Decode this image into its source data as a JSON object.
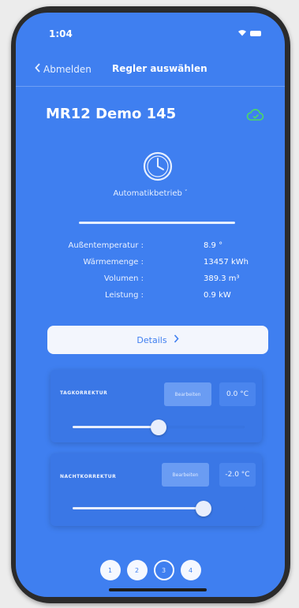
{
  "status_bar": {
    "time": "1:04"
  },
  "nav": {
    "back_label": "Abmelden",
    "title": "Regler auswählen"
  },
  "card": {
    "title": "MR12 Demo 145",
    "mode_label": "Automatikbetrieb",
    "cloud_icon": "cloud-sync-icon",
    "mode_icon": "clock-icon"
  },
  "readings": [
    {
      "label": "Außentemperatur :",
      "value": "8.9 °"
    },
    {
      "label": "Wärmemenge :",
      "value": "13457 kWh"
    },
    {
      "label": "Volumen :",
      "value": "389.3 m³"
    },
    {
      "label": "Leistung :",
      "value": "0.9 kW"
    }
  ],
  "details_button": {
    "label": "Details"
  },
  "corrections": [
    {
      "label": "TAGKORREKTUR",
      "edit_label": "Bearbeiten",
      "value": "0.0 °C",
      "slider_fraction": 0.5
    },
    {
      "label": "NACHTKORREKTUR",
      "edit_label": "Bearbeiten",
      "value": "-2.0 °C",
      "slider_fraction": 0.76
    }
  ],
  "pager": {
    "pages": [
      "1",
      "2",
      "3",
      "4"
    ],
    "active_index": 2
  },
  "colors": {
    "background": "#3f7ff0",
    "accent_green": "#4cd964"
  }
}
